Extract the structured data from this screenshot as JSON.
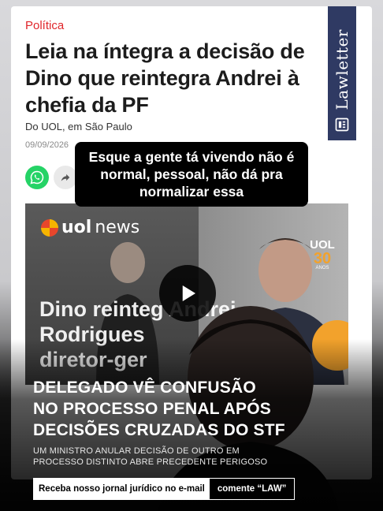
{
  "article": {
    "category": "Política",
    "headline": "Leia na íntegra a decisão de Dino que reintegra Andrei à chefia da PF",
    "source": "Do UOL, em São Paulo",
    "date": "09/09/2026"
  },
  "badge": {
    "label": "Lawletter"
  },
  "caption": {
    "text": "Esque a gente tá vivendo não é normal, pessoal, não dá pra normalizar essa"
  },
  "video": {
    "brand_uol": "uol",
    "brand_news": "news",
    "badge_uol": "UOL",
    "badge_number": "30",
    "badge_anos": "ANOS",
    "title": "Dino reinteg  Andrei\nRodrigues\ndiretor-ger"
  },
  "overlay": {
    "title": "DELEGADO VÊ CONFUSÃO\nNO PROCESSO PENAL APÓS\nDECISÕES CRUZADAS DO STF",
    "subtitle": "UM MINISTRO ANULAR DECISÃO DE OUTRO EM\nPROCESSO DISTINTO ABRE PRECEDENTE PERIGOSO"
  },
  "cta": {
    "left": "Receba nosso jornal jurídico no e-mail",
    "right": "comente “LAW”"
  },
  "colors": {
    "category": "#e0262b",
    "lawletter_bg": "#2f3a63",
    "whatsapp": "#25d366",
    "uol_accent": "#f2a22c"
  },
  "icons": [
    "whatsapp-icon",
    "share-icon",
    "newspaper-icon",
    "play-icon"
  ]
}
